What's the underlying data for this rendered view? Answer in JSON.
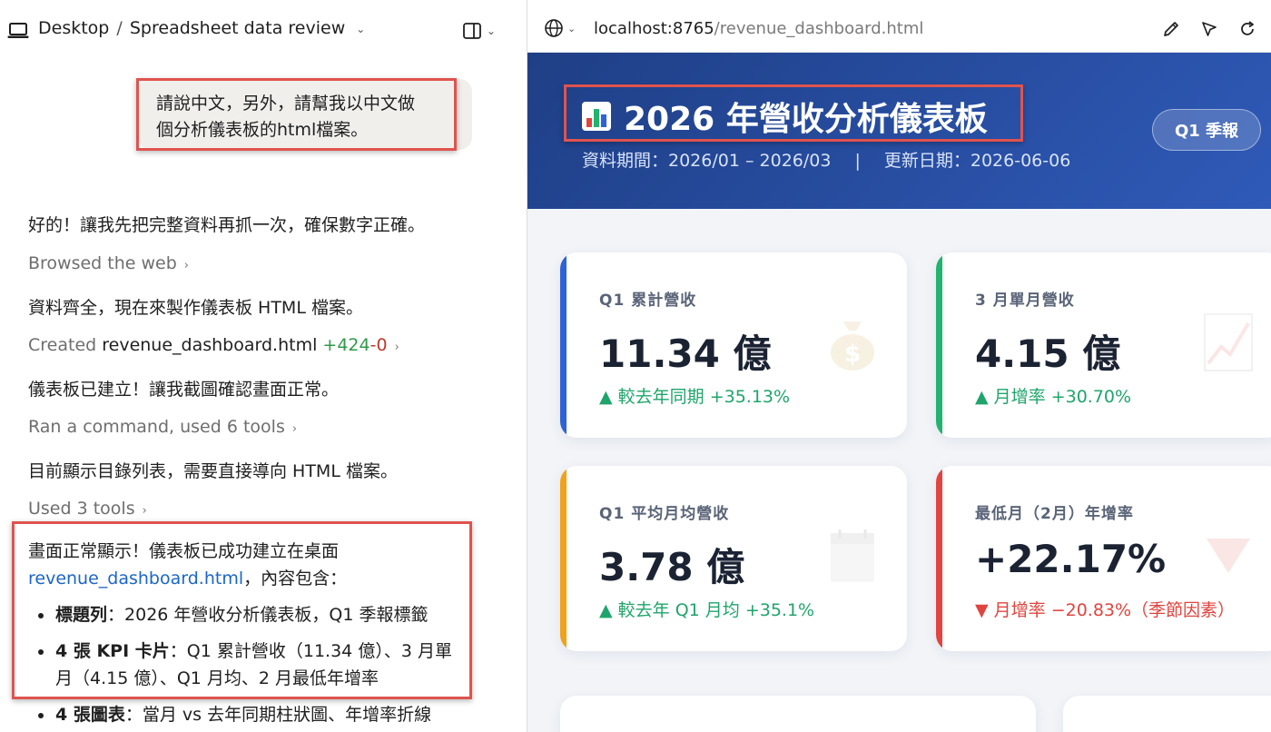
{
  "chat": {
    "breadcrumb": {
      "root": "Desktop",
      "separator": "/",
      "title": "Spreadsheet data review"
    },
    "user_message": {
      "line1": "請說中文，另外，請幫我以中文做",
      "line2": "個分析儀表板的html檔案。"
    },
    "messages": [
      "好的！讓我先把完整資料再抓一次，確保數字正確。",
      "資料齊全，現在來製作儀表板 HTML 檔案。",
      "儀表板已建立！讓我截圖確認畫面正常。",
      "目前顯示目錄列表，需要直接導向 HTML 檔案。"
    ],
    "tools": {
      "browsed": "Browsed the web",
      "created_prefix": "Created",
      "created_file": "revenue_dashboard.html",
      "created_added": "+424",
      "created_removed": "-0",
      "ran": "Ran a command, used 6 tools",
      "used": "Used 3 tools"
    },
    "final": {
      "intro": "畫面正常顯示！儀表板已成功建立在桌面",
      "link": "revenue_dashboard.html",
      "after_link": "，內容包含：",
      "bullets": [
        {
          "bold": "標題列",
          "text": "：2026 年營收分析儀表板，Q1 季報標籤"
        },
        {
          "bold": "4 張 KPI 卡片",
          "text": "：Q1 累計營收（11.34 億）、3 月單月（4.15 億）、Q1 月均、2 月最低年增率"
        },
        {
          "bold": "4 張圖表",
          "text": "：當月 vs 去年同期柱狀圖、年增率折線"
        }
      ]
    }
  },
  "browser": {
    "url_host": "localhost:8765",
    "url_path": "/revenue_dashboard.html"
  },
  "dashboard": {
    "title": "2026 年營收分析儀表板",
    "subtitle_period": "資料期間：2026/01 – 2026/03",
    "subtitle_sep": "|",
    "subtitle_updated": "更新日期：2026-06-06",
    "badge": "Q1 季報",
    "kpis": [
      {
        "label": "Q1 累計營收",
        "value": "11.34 億",
        "delta": "▲ 較去年同期 +35.13%",
        "trend": "up",
        "accent": "#2f62d6",
        "icon": "money-bag-icon"
      },
      {
        "label": "3 月單月營收",
        "value": "4.15 億",
        "delta": "▲ 月增率 +30.70%",
        "trend": "up",
        "accent": "#22b36f",
        "icon": "chart-up-icon"
      },
      {
        "label": "Q1 平均月均營收",
        "value": "3.78 億",
        "delta": "▲ 較去年 Q1 月均 +35.1%",
        "trend": "up",
        "accent": "#f0a21c",
        "icon": "calendar-icon"
      },
      {
        "label": "最低月（2月）年增率",
        "value": "+22.17%",
        "delta": "▼ 月增率 −20.83%（季節因素）",
        "trend": "down",
        "accent": "#e2443f",
        "icon": "down-triangle-icon"
      }
    ]
  }
}
